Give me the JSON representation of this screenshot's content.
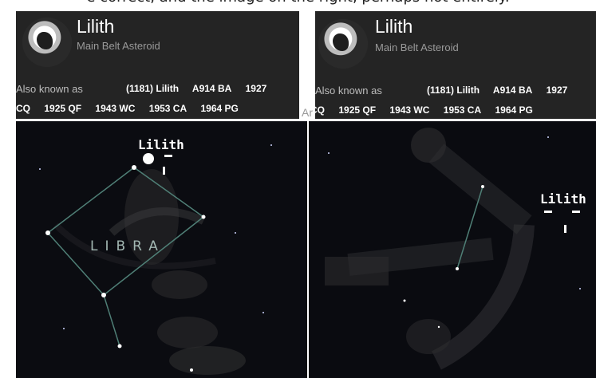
{
  "caption_top": "e correct, and the image on the right, perhaps not entirely.",
  "card_left": {
    "name": "Lilith",
    "type": "Main Belt Asteroid",
    "aka_label": "Also known as",
    "line1": [
      "(1181) Lilith",
      "A914 BA",
      "1927"
    ],
    "line2": [
      "CQ",
      "1925 QF",
      "1943 WC",
      "1953 CA",
      "1964 PG"
    ]
  },
  "card_right": {
    "name": "Lilith",
    "type": "Main Belt Asteroid",
    "aka_label": "Also known as",
    "line1": [
      "(1181) Lilith",
      "A914 BA",
      "1927"
    ],
    "line2": [
      "CQ",
      "1925 QF",
      "1943 WC",
      "1953 CA",
      "1964 PG"
    ]
  },
  "split_overflow_label": "Ar",
  "sky_left": {
    "object_label": "Lilith",
    "constellation_label": "LIBRA"
  },
  "sky_right": {
    "object_label": "Lilith"
  }
}
